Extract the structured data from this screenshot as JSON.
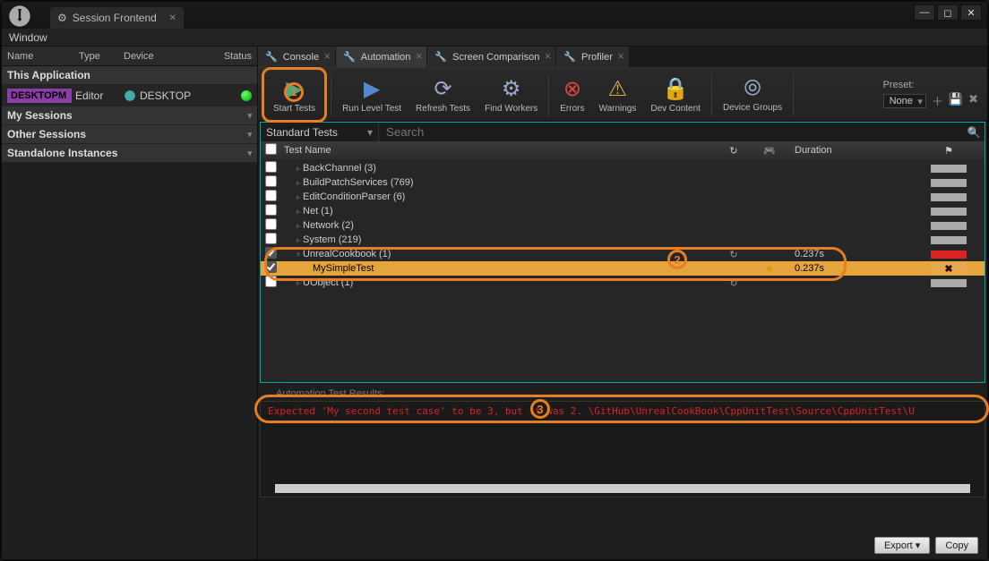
{
  "window": {
    "title": "Session Frontend",
    "menu": "Window"
  },
  "left": {
    "headers": {
      "name": "Name",
      "type": "Type",
      "device": "Device",
      "status": "Status"
    },
    "sections": {
      "this_app": "This Application",
      "my_sessions": "My Sessions",
      "other_sessions": "Other Sessions",
      "standalone": "Standalone Instances"
    },
    "app": {
      "name": "DESKTOPM",
      "type": "Editor",
      "device": "DESKTOP"
    }
  },
  "tabs": [
    {
      "label": "Console"
    },
    {
      "label": "Automation"
    },
    {
      "label": "Screen Comparison"
    },
    {
      "label": "Profiler"
    }
  ],
  "toolbar": {
    "start": "Start Tests",
    "run_level": "Run Level Test",
    "refresh": "Refresh Tests",
    "find_workers": "Find Workers",
    "errors": "Errors",
    "warnings": "Warnings",
    "dev_content": "Dev Content",
    "device_groups": "Device Groups",
    "preset_label": "Preset:",
    "preset_value": "None"
  },
  "search": {
    "dropdown": "Standard Tests",
    "placeholder": "Search"
  },
  "tree": {
    "header": {
      "name": "Test Name",
      "duration": "Duration"
    },
    "rows": [
      {
        "label": "BackChannel (3)",
        "indent": 1,
        "expand": "▹"
      },
      {
        "label": "BuildPatchServices (769)",
        "indent": 1,
        "expand": "▹"
      },
      {
        "label": "EditConditionParser (6)",
        "indent": 1,
        "expand": "▹"
      },
      {
        "label": "Net (1)",
        "indent": 1,
        "expand": "▹"
      },
      {
        "label": "Network (2)",
        "indent": 1,
        "expand": "▹"
      },
      {
        "label": "System (219)",
        "indent": 1,
        "expand": "▹"
      },
      {
        "label": "UnrealCookbook (1)",
        "indent": 1,
        "expand": "▿",
        "checked": true,
        "reload": true,
        "duration": "0.237s",
        "bar": "red"
      },
      {
        "label": "MySimpleTest",
        "indent": 2,
        "checked": true,
        "selected": true,
        "star": true,
        "duration": "0.237s",
        "bar": "fail"
      },
      {
        "label": "UObject (1)",
        "indent": 1,
        "expand": "▹",
        "reload": true
      }
    ]
  },
  "results": {
    "title": "Automation Test Results:",
    "line": "Expected 'My second test case' to be 3, but it was 2.      \\GitHub\\UnrealCookBook\\CppUnitTest\\Source\\CppUnitTest\\U"
  },
  "bottom": {
    "export": "Export",
    "copy": "Copy"
  },
  "callouts": {
    "one": "1",
    "two": "2",
    "three": "3"
  }
}
